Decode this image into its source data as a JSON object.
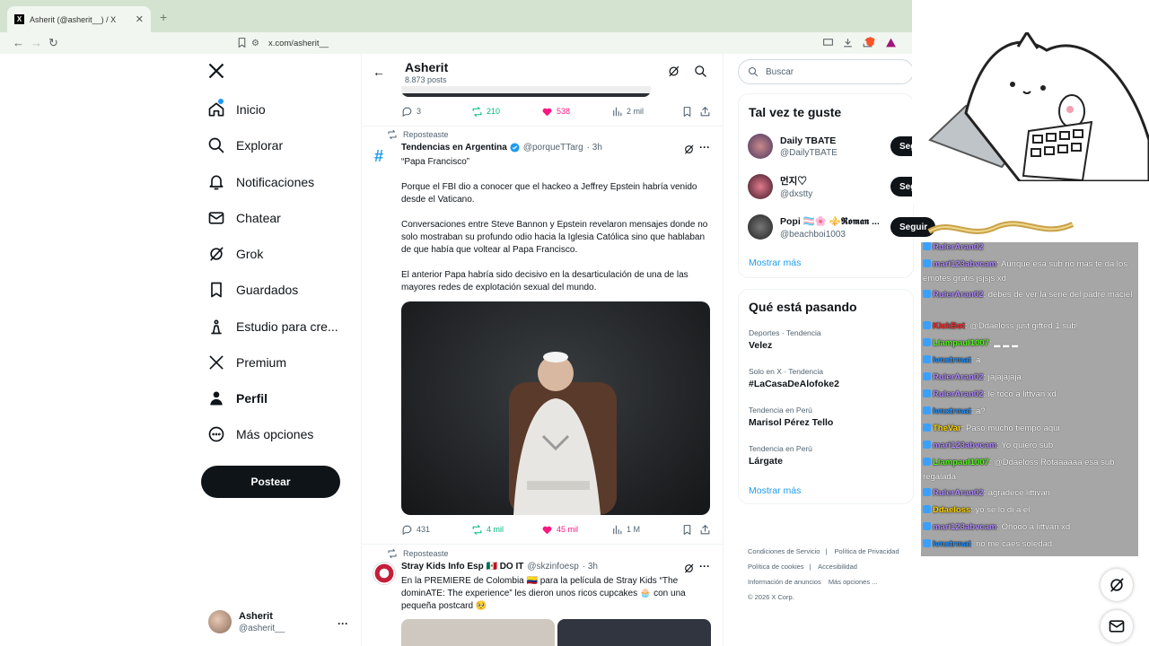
{
  "browser": {
    "tab_title": "Asherit (@asherit__) / X",
    "url": "x.com/asherit__"
  },
  "nav": {
    "items": [
      {
        "label": "Inicio",
        "icon": "home-icon"
      },
      {
        "label": "Explorar",
        "icon": "search-icon"
      },
      {
        "label": "Notificaciones",
        "icon": "bell-icon"
      },
      {
        "label": "Chatear",
        "icon": "mail-icon"
      },
      {
        "label": "Grok",
        "icon": "grok-icon"
      },
      {
        "label": "Guardados",
        "icon": "bookmark-icon"
      },
      {
        "label": "Estudio para cre...",
        "icon": "creator-studio-icon"
      },
      {
        "label": "Premium",
        "icon": "x-logo-icon"
      },
      {
        "label": "Perfil",
        "icon": "person-icon"
      },
      {
        "label": "Más opciones",
        "icon": "more-circle-icon"
      }
    ],
    "post_button": "Postear",
    "account": {
      "name": "Asherit",
      "handle": "@asherit__"
    }
  },
  "profile_header": {
    "title": "Asherit",
    "posts": "8.873 posts"
  },
  "tweet0": {
    "replies": "3",
    "reposts": "210",
    "likes": "538",
    "views": "2 mil"
  },
  "tweet1": {
    "repost_label": "Reposteaste",
    "name": "Tendencias en Argentina",
    "handle": "@porqueTTarg",
    "time": "· 3h",
    "paragraphs": [
      "“Papa Francisco”",
      "Porque el FBI dio a conocer que el hackeo a Jeffrey Epstein habría venido desde el Vaticano.",
      "Conversaciones entre Steve Bannon y Epstein revelaron mensajes donde no solo mostraban su profundo odio hacia la Iglesia Católica sino que hablaban de que había que voltear al Papa Francisco.",
      "El anterior Papa habría sido decisivo en la desarticulación de una de las mayores redes de explotación sexual del mundo."
    ],
    "replies": "431",
    "reposts": "4 mil",
    "likes": "45 mil",
    "views": "1 M"
  },
  "tweet2": {
    "repost_label": "Reposteaste",
    "name": "Stray Kids Info Esp 🇲🇽 DO IT",
    "handle": "@skzinfoesp",
    "time": "· 3h",
    "text": "En la PREMIERE de Colombia 🇨🇴 para la película de Stray Kids “The dominATE: The experience” les dieron unos ricos cupcakes 🧁 con una pequeña postcard 🥺"
  },
  "right": {
    "search_placeholder": "Buscar",
    "suggest_title": "Tal vez te guste",
    "suggestions": [
      {
        "name": "Daily TBATE",
        "handle": "@DailyTBATE"
      },
      {
        "name": "먼지♡",
        "handle": "@dxstty"
      },
      {
        "name": "Popi 🏳️‍⚧️🌸 ⚜️𝕽𝖔𝖒𝖆𝖓 ...",
        "handle": "@beachboi1003"
      }
    ],
    "follow_label": "Seguir",
    "show_more": "Mostrar más",
    "trends_title": "Qué está pasando",
    "trends": [
      {
        "context": "Deportes · Tendencia",
        "name": "Velez"
      },
      {
        "context": "Solo en X · Tendencia",
        "name": "#LaCasaDeAlofoke2"
      },
      {
        "context": "Tendencia en Perú",
        "name": "Marisol Pérez Tello"
      },
      {
        "context": "Tendencia en Perú",
        "name": "Lárgate"
      }
    ],
    "footer": [
      "Condiciones de Servicio",
      "Política de Privacidad",
      "Política de cookies",
      "Accesibilidad",
      "Información de anuncios",
      "Más opciones ...",
      "© 2026 X Corp."
    ]
  },
  "overlay": {
    "chat": [
      {
        "user": "RulerAran02",
        "text": "",
        "color": "#b18cff"
      },
      {
        "user": "mari123abvcam",
        "text": ": Aunque esa sub no mas te da los emotes gratis jsjsjs xd",
        "color": "#b18cff"
      },
      {
        "user": "RulerAran02",
        "text": ": debes de ver la serie del padre maciel",
        "color": "#b18cff"
      },
      {
        "user": "KickBot",
        "text": ": @Ddaeloss just gifted 1 sub!",
        "color": "#ff2a2a"
      },
      {
        "user": "Llampaul1007",
        "text": ": ▂ ▂ ▂",
        "color": "#53fc18"
      },
      {
        "user": "lvnxtrmat",
        "text": ": a",
        "color": "#1e90ff"
      },
      {
        "user": "RulerAran02",
        "text": ": jajajajaja",
        "color": "#b18cff"
      },
      {
        "user": "RulerAran02",
        "text": ": le toco a littvan xd",
        "color": "#b18cff"
      },
      {
        "user": "lvnxtrmat",
        "text": ": a?",
        "color": "#1e90ff"
      },
      {
        "user": "TheVar",
        "text": ": Paso mucho tiempo aqui",
        "color": "#ffd700"
      },
      {
        "user": "mari123abvcam",
        "text": ": Yo quiero sub",
        "color": "#b18cff"
      },
      {
        "user": "Llampaul1007",
        "text": ": @Ddaeloss Rotaaaaaa esa sub regalada",
        "color": "#53fc18"
      },
      {
        "user": "RulerAran02",
        "text": ": agradece littivan",
        "color": "#b18cff"
      },
      {
        "user": "Ddaeloss",
        "text": ": yo se lo di a el",
        "color": "#ffd700"
      },
      {
        "user": "mari123abvcam",
        "text": ": Oñooo a littvan xd",
        "color": "#b18cff"
      },
      {
        "user": "lvnxtrmat",
        "text": ": no me caes soledad",
        "color": "#1e90ff"
      }
    ]
  }
}
